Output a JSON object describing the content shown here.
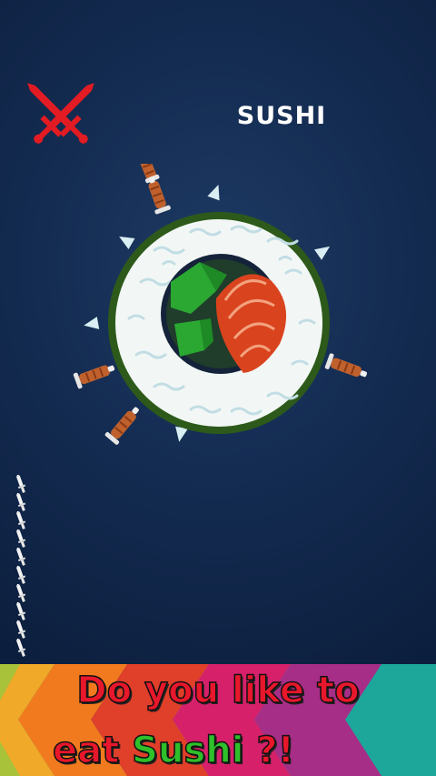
{
  "title": "SUSHI",
  "icons": {
    "menu": "crossed-swords-icon",
    "knives_remaining": "throwing-knife-icon"
  },
  "knives_remaining": 10,
  "knives_stuck": 5,
  "banner": {
    "line1": "Do you like to",
    "line2_prefix": "eat ",
    "line2_highlight": "Sushi",
    "line2_suffix": " ?!"
  },
  "colors": {
    "background": "#142c52",
    "accent_red": "#e8172b",
    "highlight_green": "#2fbf2a",
    "title_white": "#ffffff"
  }
}
